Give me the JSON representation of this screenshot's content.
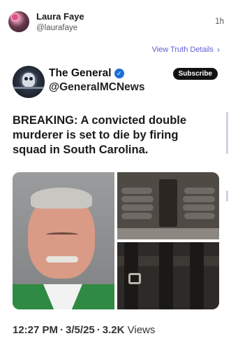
{
  "post": {
    "author_name": "Laura Faye",
    "author_handle": "@laurafaye",
    "time": "1h",
    "view_link": "View Truth Details"
  },
  "card": {
    "name": "The General",
    "handle": "@GeneralMCNews",
    "subscribe_label": "Subscribe",
    "text": "BREAKING: A convicted double murderer is set to die by firing squad in South Carolina.",
    "timestamp": "12:27 PM",
    "date": "3/5/25",
    "views_count": "3.2K",
    "views_label": "Views"
  },
  "icons": {
    "verified": "verified-badge-icon",
    "chevron": "chevron-right-icon"
  },
  "colors": {
    "link": "#5b5fd6",
    "verified": "#1d6fd8"
  }
}
